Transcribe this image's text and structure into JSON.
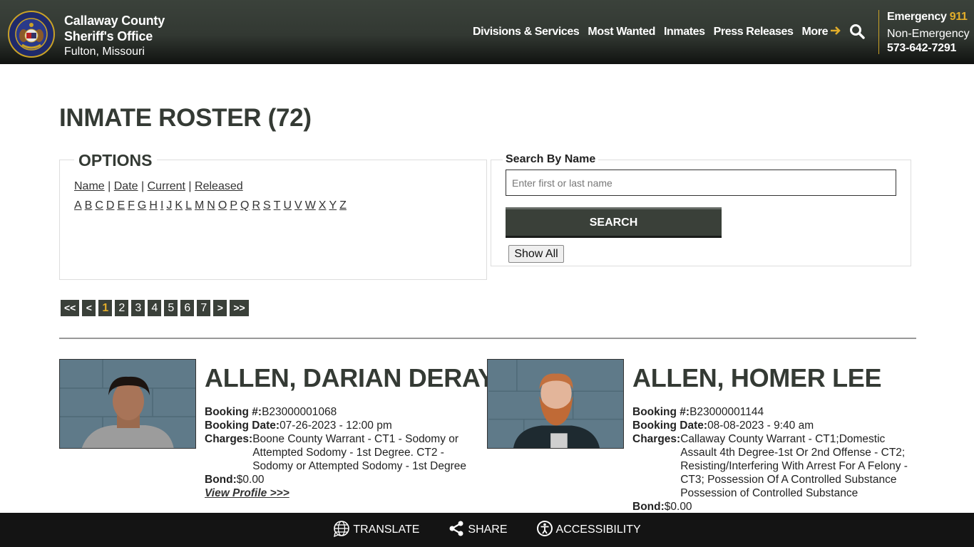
{
  "header": {
    "brand_line1": "Callaway County",
    "brand_line2": "Sheriff's Office",
    "brand_line3": "Fulton, Missouri",
    "nav": [
      {
        "label": "Divisions & Services"
      },
      {
        "label": "Most Wanted"
      },
      {
        "label": "Inmates"
      },
      {
        "label": "Press Releases"
      },
      {
        "label": "More"
      }
    ],
    "search_icon": "magnifier-icon",
    "emergency_label": "Emergency",
    "emergency_number": "911",
    "nonemergency_label": "Non-Emergency",
    "nonemergency_phone": "573-642-7291",
    "accent_color": "#e2ad2a"
  },
  "page": {
    "title": "INMATE ROSTER (72)"
  },
  "options": {
    "legend": "OPTIONS",
    "sort_links": [
      "Name",
      "Date",
      "Current",
      "Released"
    ],
    "separator": "|",
    "letters": [
      "A",
      "B",
      "C",
      "D",
      "E",
      "F",
      "G",
      "H",
      "I",
      "J",
      "K",
      "L",
      "M",
      "N",
      "O",
      "P",
      "Q",
      "R",
      "S",
      "T",
      "U",
      "V",
      "W",
      "X",
      "Y",
      "Z"
    ]
  },
  "search": {
    "legend": "Search By Name",
    "placeholder": "Enter first or last name",
    "value": "",
    "button_label": "SEARCH",
    "show_all_label": "Show All"
  },
  "pagination": {
    "first": "<<",
    "prev": "<",
    "pages": [
      "1",
      "2",
      "3",
      "4",
      "5",
      "6",
      "7"
    ],
    "current": "1",
    "next": ">",
    "last": ">>"
  },
  "inmates": [
    {
      "name": "ALLEN, DARIAN DERAY",
      "booking_no_label": "Booking #:",
      "booking_no": "B23000001068",
      "booking_date_label": "Booking Date:",
      "booking_date": "07-26-2023 - 12:00 pm",
      "charges_label": "Charges:",
      "charges": "Boone County Warrant - CT1 - Sodomy or Attempted Sodomy - 1st Degree. CT2 - Sodomy or Attempted Sodomy - 1st Degree",
      "bond_label": "Bond:",
      "bond": "$0.00",
      "profile_link": "View Profile >>>"
    },
    {
      "name": "ALLEN, HOMER LEE",
      "booking_no_label": "Booking #:",
      "booking_no": "B23000001144",
      "booking_date_label": "Booking Date:",
      "booking_date": "08-08-2023 - 9:40 am",
      "charges_label": "Charges:",
      "charges": "Callaway County Warrant - CT1;Domestic Assault 4th Degree-1st Or 2nd Offense - CT2; Resisting/Interfering With Arrest For A Felony - CT3; Possession Of A Controlled Substance Possession of Controlled Substance",
      "bond_label": "Bond:",
      "bond": "$0.00"
    }
  ],
  "footer": {
    "translate": "TRANSLATE",
    "share": "SHARE",
    "accessibility": "ACCESSIBILITY"
  }
}
